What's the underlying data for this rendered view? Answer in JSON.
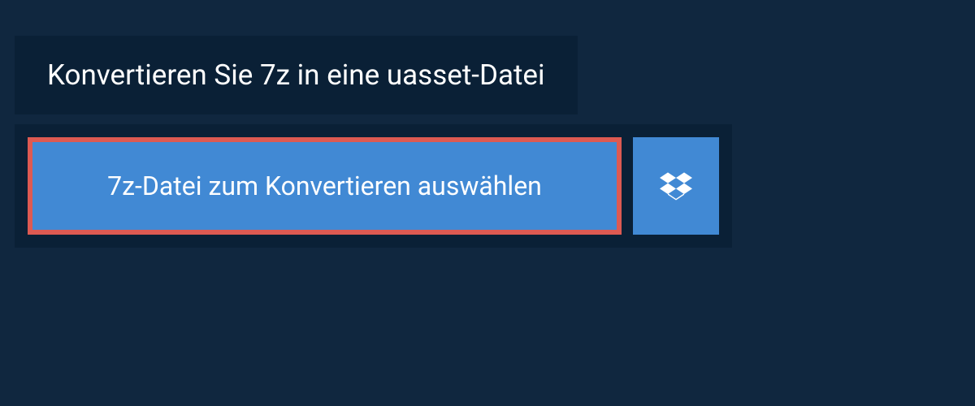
{
  "header": {
    "title": "Konvertieren Sie 7z in eine uasset-Datei"
  },
  "panel": {
    "select_button_label": "7z-Datei zum Konvertieren auswählen"
  },
  "colors": {
    "page_bg": "#10273f",
    "panel_bg": "#0a2036",
    "button_bg": "#4189d4",
    "highlight_border": "#dd5a52"
  }
}
